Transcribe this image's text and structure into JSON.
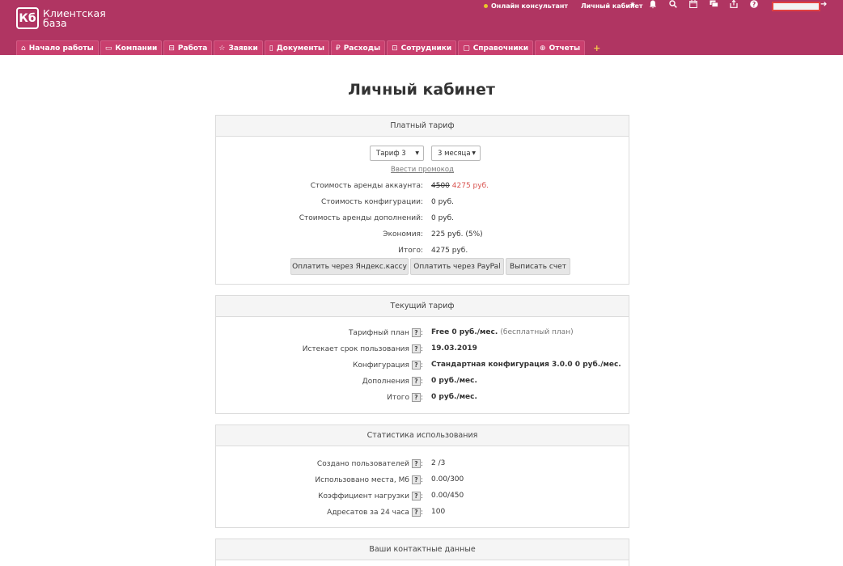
{
  "header": {
    "logo_mark": "Кб",
    "logo_text": "Клиентская база",
    "online_consultant": "Онлайн консультант",
    "cabinet_link": "Личный кабинет",
    "icons": [
      "gear-icon",
      "bell-icon",
      "search-icon",
      "calendar-icon",
      "chat-icon",
      "export-icon",
      "help-icon"
    ],
    "logout_icon": "logout-icon"
  },
  "nav": {
    "tabs": [
      {
        "label": "Начало работы",
        "icon": "⌂"
      },
      {
        "label": "Компании",
        "icon": "▭"
      },
      {
        "label": "Работа",
        "icon": "⊟"
      },
      {
        "label": "Заявки",
        "icon": "☆"
      },
      {
        "label": "Документы",
        "icon": "▯"
      },
      {
        "label": "Расходы",
        "icon": "₽"
      },
      {
        "label": "Сотрудники",
        "icon": "⊡"
      },
      {
        "label": "Справочники",
        "icon": "▢"
      },
      {
        "label": "Отчеты",
        "icon": "⊕"
      }
    ],
    "add": "+"
  },
  "page": {
    "title": "Личный кабинет"
  },
  "paid": {
    "title": "Платный тариф",
    "tariff_select": "Тариф 3",
    "period_select": "3 месяца",
    "promo_link": "Ввести промокод",
    "rows": [
      {
        "label": "Стоимость аренды аккаунта:",
        "old": "4500",
        "value": "4275 руб."
      },
      {
        "label": "Стоимость конфигурации:",
        "value": "0 руб."
      },
      {
        "label": "Стоимость аренды дополнений:",
        "value": "0 руб."
      },
      {
        "label": "Экономия:",
        "value": "225 руб. (5%)"
      },
      {
        "label": "Итого:",
        "value": "4275 руб."
      }
    ],
    "btn_yandex": "Оплатить через Яндекс.кассу",
    "btn_paypal": "Оплатить через PayPal",
    "btn_invoice": "Выписать счет"
  },
  "current": {
    "title": "Текущий тариф",
    "rows": [
      {
        "label": "Тарифный план",
        "value": "Free  0 руб./мес.",
        "note": "(бесплатный план)"
      },
      {
        "label": "Истекает срок пользования",
        "value": "19.03.2019"
      },
      {
        "label": "Конфигурация",
        "value": "Стандартная конфигурация 3.0.0 0 руб./мес."
      },
      {
        "label": "Дополнения",
        "value": "0 руб./мес."
      },
      {
        "label": "Итого",
        "value": "0 руб./мес."
      }
    ]
  },
  "stats": {
    "title": "Статистика использования",
    "rows": [
      {
        "label": "Создано пользователей",
        "value": "2 /3"
      },
      {
        "label": "Использовано места, Мб",
        "value": "0.00/300"
      },
      {
        "label": "Коэффициент нагрузки",
        "value": "0.00/450"
      },
      {
        "label": "Адресатов за 24 часа",
        "value": "100"
      }
    ]
  },
  "contacts": {
    "title": "Ваши контактные данные"
  },
  "help_mark": "?",
  "colon": ":"
}
